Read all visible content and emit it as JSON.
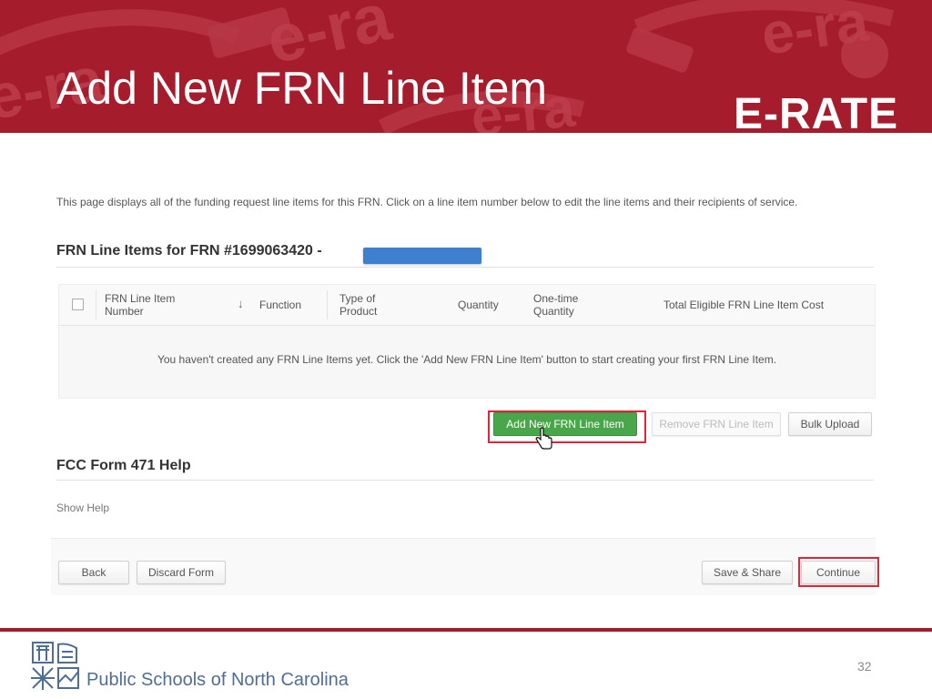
{
  "slide": {
    "title": "Add New FRN Line Item",
    "logo_text": "E-RATE",
    "organization": "Public Schools of North Carolina",
    "page_number": "32"
  },
  "colors": {
    "banner": "#a51c2c",
    "primary_button": "#4aa64a",
    "highlight": "#e0243a",
    "redaction": "#3f7fcf",
    "org_text": "#4f6e96"
  },
  "screen": {
    "intro": "This page displays all of the funding request line items for this FRN. Click on a line item number below to edit the line items and their recipients of service.",
    "section_title": "FRN Line Items for FRN #1699063420 - ",
    "table": {
      "columns": [
        "FRN Line Item Number",
        "Function",
        "Type of Product",
        "Quantity",
        "One-time Quantity",
        "Total Eligible FRN Line Item Cost"
      ],
      "sort_icon": "arrow-down-icon",
      "empty_message": "You haven't created any FRN Line Items yet. Click the 'Add New FRN Line Item' button to start creating your first FRN Line Item."
    },
    "buttons": {
      "add_line_item": "Add New FRN Line Item",
      "remove_line_item": "Remove FRN Line Item",
      "bulk_upload": "Bulk Upload",
      "back": "Back",
      "discard_form": "Discard Form",
      "save_share": "Save & Share",
      "continue": "Continue"
    },
    "help": {
      "title": "FCC Form 471 Help",
      "show_help": "Show Help"
    }
  }
}
